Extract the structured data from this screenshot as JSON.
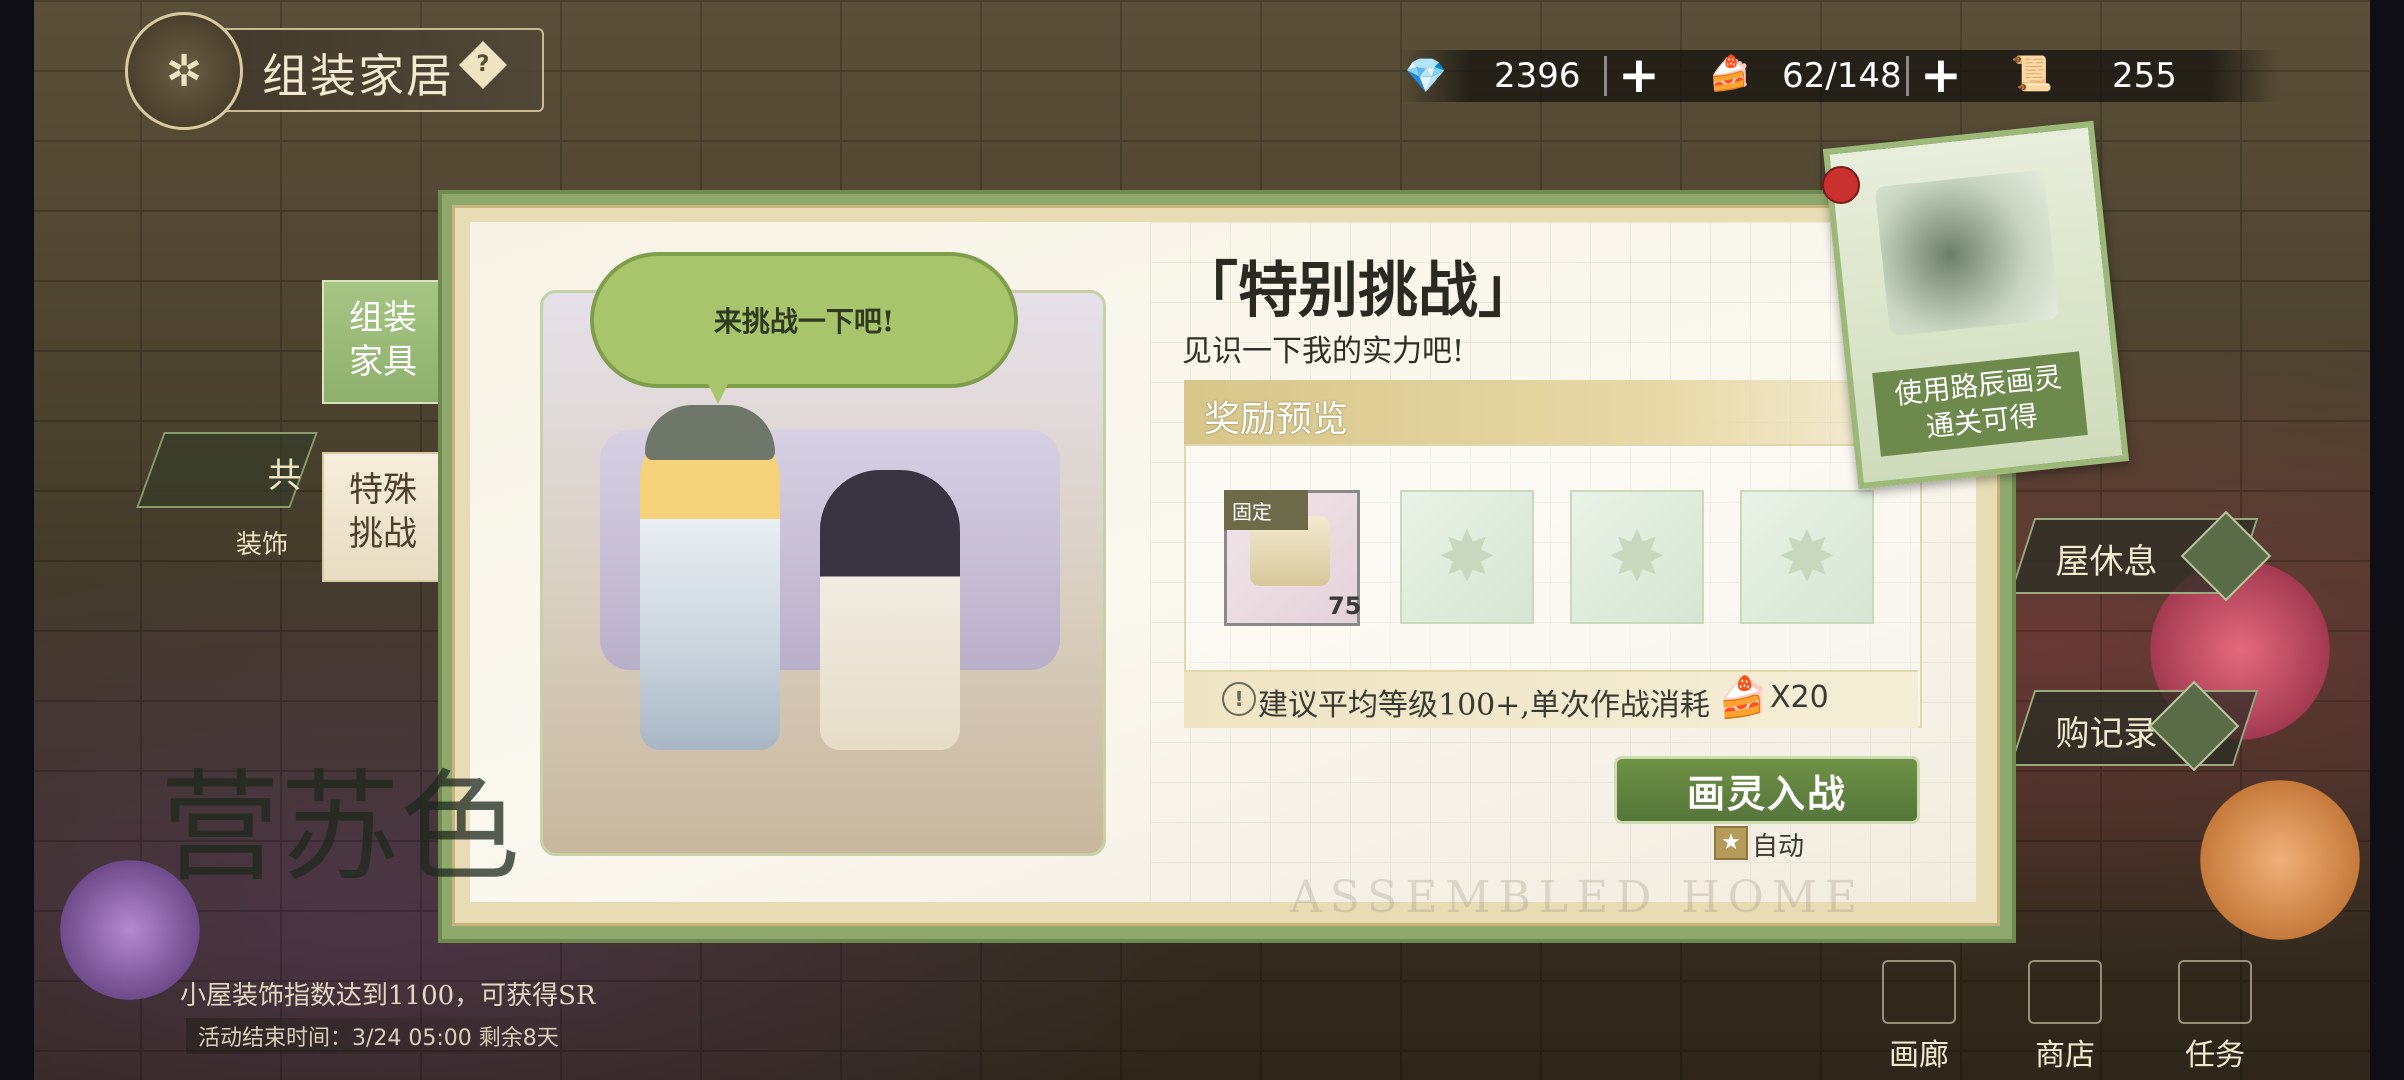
{
  "header": {
    "title": "组装家居",
    "help_icon": "question-icon",
    "help_glyph": "?"
  },
  "currencies": [
    {
      "icon": "diamond-icon",
      "value": "2396",
      "has_plus": true
    },
    {
      "icon": "strawberry-cake-icon",
      "value": "62/148",
      "has_plus": true
    },
    {
      "icon": "scroll-ticket-icon",
      "value": "255",
      "has_plus": false
    }
  ],
  "plus_glyph": "+",
  "left_tabs": {
    "assemble": "组装\n家具",
    "special": "特殊\n挑战",
    "behind_item_label": "共",
    "behind_decor_label": "装饰"
  },
  "dialog": {
    "speech": "来挑战一下吧!",
    "title": "「特别挑战」",
    "subtitle": "见识一下我的实力吧!",
    "reward_header": "奖励预览",
    "fixed_tag": "固定",
    "reward_count": "75",
    "tip_text": "建议平均等级100+,单次作战消耗",
    "tip_mult": "X20",
    "battle_button": "画灵入战",
    "auto_label": "自动",
    "watermark": "ASSEMBLED HOME"
  },
  "card": {
    "text": "使用路辰画灵\n通关可得"
  },
  "side_menu": [
    {
      "label": "屋休息",
      "icon": "rest-icon"
    },
    {
      "label": "购记录",
      "icon": "cart-icon"
    }
  ],
  "event": {
    "logo_text": "营苏色",
    "line1": "小屋装饰指数达到1100，可获得SR",
    "line2": "活动结束时间：3/24  05:00   剩余8天"
  },
  "bottom_nav": [
    {
      "label": "画廊",
      "icon": "gallery-icon"
    },
    {
      "label": "商店",
      "icon": "shop-icon"
    },
    {
      "label": "任务",
      "icon": "task-icon"
    }
  ],
  "colors": {
    "accent_green": "#6f9146",
    "gold": "#d8c68a",
    "panel_bg": "#f7f3e6"
  }
}
